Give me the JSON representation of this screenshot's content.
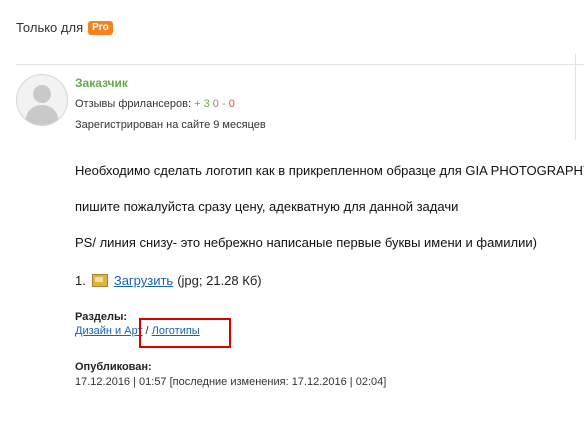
{
  "header": {
    "only_for": "Только для",
    "pro_badge": "Pro"
  },
  "customer": {
    "label": "Заказчик",
    "reviews_label": "Отзывы фрилансеров:",
    "reviews_positive": "+ 3",
    "reviews_neutral": "0",
    "reviews_separator": "-",
    "reviews_negative": "0",
    "registered": "Зарегистрирован на сайте 9 месяцев"
  },
  "description": {
    "line1": "Необходимо сделать логотип как в прикрепленном образце для GIA PHOTOGRAPHY",
    "line2": "пишите пожалуйста сразу цену, адекватную для данной задачи",
    "line3": "PS/ линия снизу- это  небрежно написаные первые буквы имени и фамилии)"
  },
  "attachment": {
    "index": "1.",
    "icon": "image-file-icon",
    "link_label": "Загрузить",
    "info": "(jpg; 21.28 Кб)"
  },
  "sections": {
    "title": "Разделы:",
    "category": "Дизайн и Арт",
    "separator": "/",
    "subcategory": "Логотипы"
  },
  "published": {
    "title": "Опубликован:",
    "value": "17.12.2016 | 01:57 [последние изменения: 17.12.2016 | 02:04]"
  },
  "colors": {
    "accent_green": "#6aa84f",
    "pro_orange": "#f5821f",
    "link_blue": "#1a5fb4",
    "highlight_red": "#d90000"
  }
}
